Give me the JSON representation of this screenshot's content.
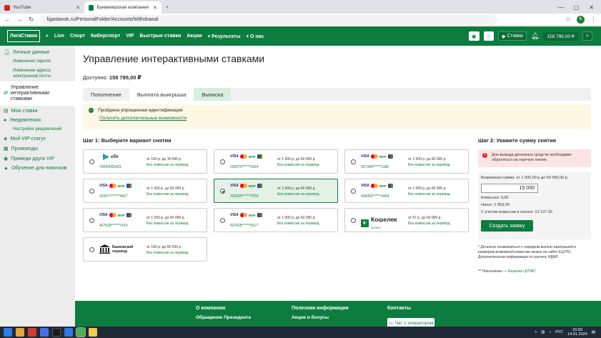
{
  "browser": {
    "tabs": [
      {
        "title": "YouTube",
        "color": "#e62117"
      },
      {
        "title": "Букмекерская компания «Лиг...",
        "color": "#0d7d3f"
      }
    ],
    "new_tab": "+",
    "url": "ligastavok.ru/PersonalFolder/Accounts/Withdrawal",
    "profile": "K"
  },
  "header": {
    "logo": "ЛигаСтавок",
    "menu": [
      "Live",
      "Спорт",
      "Киберспорт",
      "VIP",
      "Быстрые ставки",
      "Акции",
      "▾ Результаты",
      "▾ О нас"
    ],
    "stakes_label": "Ставки",
    "balance": "158 795,00 ₽",
    "plus": "+"
  },
  "sidebar": {
    "items": [
      {
        "label": "Личные данные",
        "kind": "section"
      },
      {
        "label": "Изменение пароля",
        "kind": "sub"
      },
      {
        "label": "Изменение адреса электронной почты",
        "kind": "sub"
      },
      {
        "label": "Управление интерактивными ставками",
        "kind": "active"
      },
      {
        "label": "Мои ставки",
        "kind": "section"
      },
      {
        "label": "Уведомления",
        "kind": "section"
      },
      {
        "label": "Настройка уведомлений",
        "kind": "sub"
      },
      {
        "label": "Мой VIP-статус",
        "kind": "section"
      },
      {
        "label": "Промокоды",
        "kind": "section"
      },
      {
        "label": "Приведи друга VIP",
        "kind": "section"
      },
      {
        "label": "Обучение для новичков",
        "kind": "section"
      }
    ]
  },
  "main": {
    "title": "Управление интерактивными ставками",
    "available_label": "Доступно:",
    "available_value": "158 795,00 ₽",
    "tabs": [
      "Пополнение",
      "Выплата выигрыша",
      "Выписка"
    ],
    "notice": {
      "text": "Пройдена упрощенная идентификация",
      "link": "Получить дополнительные возможности"
    },
    "step1_title": "Шаг 1: Выберите вариант снятия",
    "step2_title": "Шаг 2: Укажите сумму снятия",
    "methods": [
      {
        "type": "sbp",
        "number": "79042055423",
        "limit": "от 100 р. до 15 000 р.",
        "fee": "Без комиссии за перевод",
        "selected": false
      },
      {
        "type": "card",
        "number": "220070******3424",
        "limit": "от 1 000 р. до 60 000 р.",
        "fee": "Без комиссии за перевод",
        "selected": false
      },
      {
        "type": "card",
        "number": "527349******1185",
        "limit": "от 1 000 р. до 60 000 р.",
        "fee": "Без комиссии за перевод",
        "selected": false
      },
      {
        "type": "card",
        "number": "220077******4927",
        "limit": "от 1 000 р. до 60 000 р.",
        "fee": "Без комиссии за перевод",
        "selected": false
      },
      {
        "type": "card",
        "number": "220220******7079",
        "limit": "от 1 000 р. до 60 000 р.",
        "fee": "Без комиссии за перевод",
        "selected": true
      },
      {
        "type": "card",
        "number": "439002******4454",
        "limit": "от 1 000 р. до 60 000 р.",
        "fee": "Без комиссии за перевод",
        "selected": false
      },
      {
        "type": "card",
        "number": "427628******7415",
        "limit": "от 1 000 р. до 60 000 р.",
        "fee": "Без комиссии за перевод",
        "selected": false
      },
      {
        "type": "card",
        "number": "427628******4117",
        "limit": "от 1 000 р. до 60 000 р.",
        "fee": "Без комиссии за перевод",
        "selected": false
      },
      {
        "type": "koshelek",
        "number": "",
        "limit": "от 57 р. до 60 000 р.",
        "fee": "Без комиссии за перевод",
        "selected": false
      },
      {
        "type": "bank",
        "number": "",
        "limit": "от 100 р. до 60 000 р.",
        "fee": "Без комиссии за перевод",
        "selected": false
      }
    ],
    "logo_text": {
      "sbp": "сбп",
      "visa": "VISA",
      "mir": "МИР",
      "koshelek": "Кошелек",
      "koshelek_sub": "ЦУПИС",
      "bank": "Банковский перевод"
    },
    "warning": "Для вывода денежных средств необходимо обратиться на горячую линию.",
    "amount": {
      "range": "Возможная сумма: от 1 000,00 р до 60 000,00 р.",
      "value": "15 000",
      "commission": "Комиссия: 0,00",
      "tax": "Налог: 1 863,00",
      "total": "С учетом комиссии и налога: 13 137,00",
      "submit": "Создать заявку"
    },
    "fine_print": "* Детально ознакомиться с порядком выплат выигрышей и размером возможной комиссии можно на сайте ЕЦУПС. Дополнительная информация по расчету НДФЛ.",
    "fine_print2_prefix": "** Пополнение —",
    "fine_print2_link": "Кошелек ЦУПИС"
  },
  "footer": {
    "col1": {
      "heading": "О компании",
      "item": "Обращение Президента"
    },
    "col2": {
      "heading": "Полезная информация",
      "item": "Акции и бонусы"
    },
    "col3": {
      "heading": "Контакты",
      "chat": "Чат с оператором"
    }
  },
  "taskbar": {
    "lang": "РУС",
    "time": "20:58",
    "date": "14.01.2024"
  }
}
